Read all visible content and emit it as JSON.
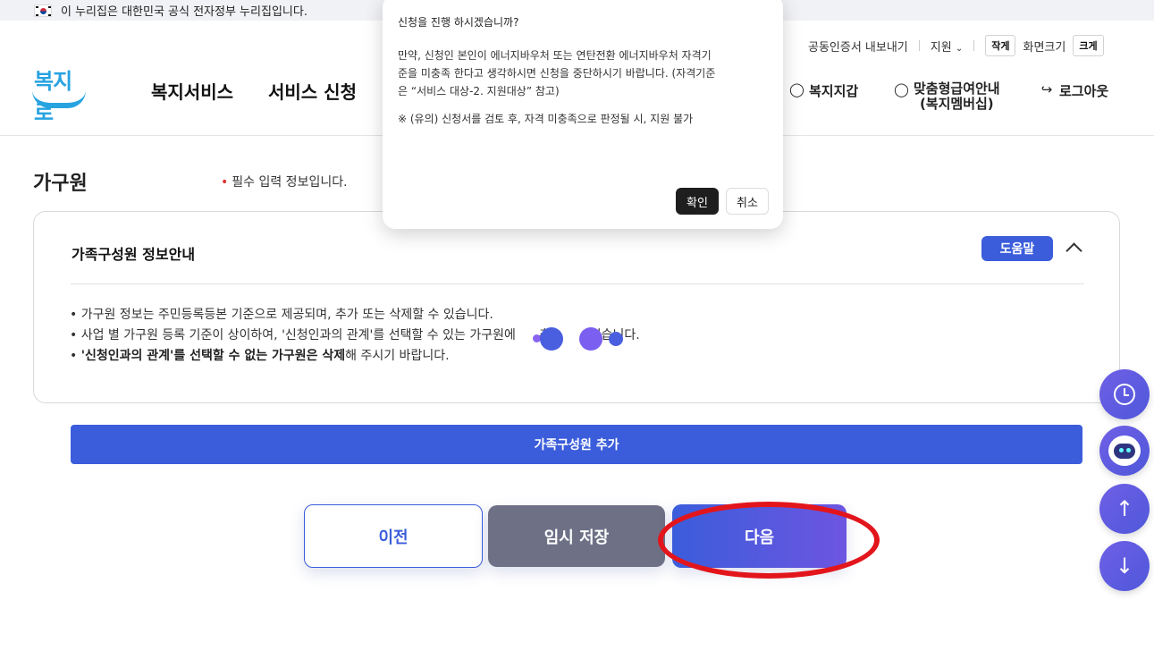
{
  "gov_banner": {
    "text": "이 누리집은 대한민국 공식 전자정부 누리집입니다."
  },
  "header": {
    "logo_text": "복지로",
    "util": {
      "cert_export": "공동인증서 내보내기",
      "support": "지원",
      "smaller": "작게",
      "screen_size": "화면크기",
      "larger": "크게"
    },
    "gnb": [
      "복지서비스",
      "서비스 신청"
    ],
    "right_nav": {
      "wallet": "복지지갑",
      "membership_line1": "맞춤형급여안내",
      "membership_line2": "(복지멤버십)",
      "logout": "로그아웃"
    }
  },
  "page": {
    "section_title": "가구원",
    "required_note": "필수 입력 정보입니다.",
    "info_box": {
      "title": "가족구성원 정보안내",
      "help_label": "도움말",
      "bullets": [
        "가구원 정보는 주민등록등본 기준으로 제공되며, 추가 또는 삭제할 수 있습니다.",
        "사업 별 가구원 등록 기준이 상이하여, '신청인과의 관계'를 선택할 수 있는 가구원에",
        "있습니다."
      ],
      "bullet2_partial": "추",
      "bullet3_bold": "'신청인과의 관계'를 선택할 수 없는 가구원은 삭제",
      "bullet3_rest": "해 주시기 바랍니다."
    },
    "add_member_label": "가족구성원 추가",
    "buttons": {
      "prev": "이전",
      "temp_save": "임시 저장",
      "next": "다음"
    }
  },
  "modal": {
    "question": "신청을 진행 하시겠습니까?",
    "body_lines": [
      "만약, 신청인 본인이 에너지바우처 또는 연탄전환 에너지바우처 자격기",
      "준을 미충족 한다고 생각하시면 신청을 중단하시기 바랍니다. (자격기준",
      "은 “서비스 대상-2. 지원대상” 참고)"
    ],
    "note": "※ (유의) 신청서를 검토 후, 자격 미충족으로 판정될 시, 지원 불가",
    "ok": "확인",
    "cancel": "취소"
  },
  "floating": {
    "history_icon": "history-icon",
    "chatbot_icon": "chatbot-icon",
    "up_icon": "arrow-up-icon",
    "down_icon": "arrow-down-icon",
    "up": "↑",
    "down": "↓"
  },
  "colors": {
    "primary": "#3b5ddb",
    "temp_btn": "#6e7186",
    "highlight": "#e3151c",
    "logo": "#27a3e0"
  }
}
